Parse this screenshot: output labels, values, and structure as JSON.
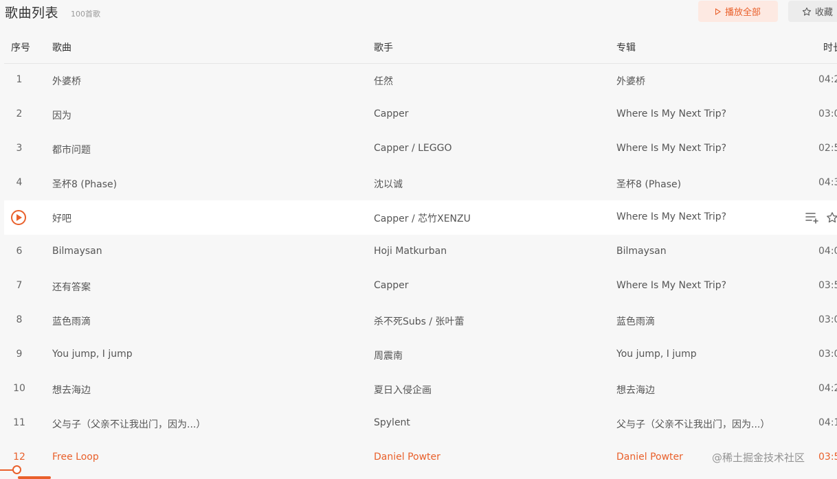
{
  "header": {
    "title": "歌曲列表",
    "count": "100首歌",
    "play_all_label": "播放全部",
    "collect_label": "收藏"
  },
  "columns": {
    "index": "序号",
    "song": "歌曲",
    "artist": "歌手",
    "album": "专辑",
    "duration": "时长"
  },
  "songs": [
    {
      "index": "1",
      "title": "外婆桥",
      "artist": "任然",
      "album": "外婆桥",
      "duration": "04:2"
    },
    {
      "index": "2",
      "title": "因为",
      "artist": "Capper",
      "album": "Where Is My Next Trip?",
      "duration": "03:0"
    },
    {
      "index": "3",
      "title": "都市问题",
      "artist": "Capper / LEGGO",
      "album": "Where Is My Next Trip?",
      "duration": "02:5"
    },
    {
      "index": "4",
      "title": "圣杯8 (Phase)",
      "artist": "沈以诚",
      "album": "圣杯8 (Phase)",
      "duration": "04:3"
    },
    {
      "index": "",
      "title": "好吧",
      "artist": "Capper / 芯竹XENZU",
      "album": "Where Is My Next Trip?",
      "duration": ""
    },
    {
      "index": "6",
      "title": "Bilmaysan",
      "artist": "Hoji Matkurban",
      "album": "Bilmaysan",
      "duration": "04:0"
    },
    {
      "index": "7",
      "title": "还有答案",
      "artist": "Capper",
      "album": "Where Is My Next Trip?",
      "duration": "03:5"
    },
    {
      "index": "8",
      "title": "蓝色雨滴",
      "artist": "杀不死Subs / 张叶蕾",
      "album": "蓝色雨滴",
      "duration": "03:0"
    },
    {
      "index": "9",
      "title": "You jump, I jump",
      "artist": "周震南",
      "album": "You jump, I jump",
      "duration": "03:0"
    },
    {
      "index": "10",
      "title": "想去海边",
      "artist": "夏日入侵企画",
      "album": "想去海边",
      "duration": "04:2"
    },
    {
      "index": "11",
      "title": "父与子（父亲不让我出门，因为...）",
      "artist": "Spylent",
      "album": "父与子（父亲不让我出门，因为...）",
      "duration": "04:1"
    },
    {
      "index": "12",
      "title": "Free Loop",
      "artist": "Daniel Powter",
      "album": "Daniel Powter",
      "duration": "03:5"
    }
  ],
  "watermark": "@稀土掘金技术社区",
  "icons": {
    "play_all": "play-icon",
    "collect": "star-icon",
    "row_play": "play-circle-icon",
    "add_to_playlist": "playlist-add-icon",
    "row_collect": "star-icon"
  },
  "colors": {
    "accent": "#e9602b",
    "background": "#f7f7f7",
    "active_row": "#ffffff"
  },
  "progress": 0.02
}
